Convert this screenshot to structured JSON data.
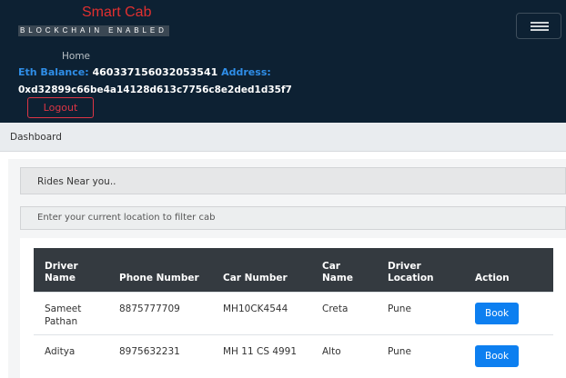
{
  "navbar": {
    "brand": "Smart Cab",
    "tagline": "BLOCKCHAIN ENABLED",
    "home": "Home",
    "eth_label": "Eth Balance:",
    "eth_value": "460337156032053541",
    "address_label": "Address:",
    "address_value": "0xd32899c66be4a14128d613c7756c8e2ded1d35f7",
    "logout": "Logout"
  },
  "breadcrumb": {
    "title": "Dashboard"
  },
  "rides": {
    "heading": "Rides Near you..",
    "placeholder": "Enter your current location to filter cab"
  },
  "table": {
    "headers": [
      "Driver Name",
      "Phone Number",
      "Car Number",
      "Car Name",
      "Driver Location",
      "Action"
    ],
    "rows": [
      {
        "driver": "Sameet Pathan",
        "phone": "8875777709",
        "car_number": "MH10CK4544",
        "car_name": "Creta",
        "location": "Pune",
        "action": "Book"
      },
      {
        "driver": "Aditya",
        "phone": "8975632231",
        "car_number": "MH 11 CS 4991",
        "car_name": "Alto",
        "location": "Pune",
        "action": "Book"
      }
    ]
  },
  "colors": {
    "navbar_bg": "#0d2133",
    "brand": "#e03030",
    "accent": "#2f8ee8",
    "danger": "#dc3545",
    "primary": "#0d7ff0",
    "table_head": "#343a40"
  }
}
